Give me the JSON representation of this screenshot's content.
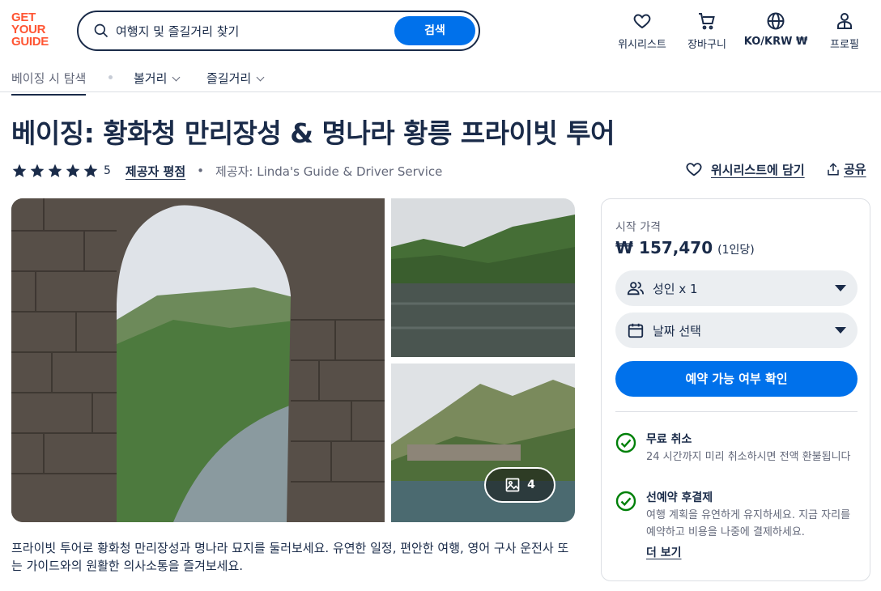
{
  "header": {
    "logo_lines": [
      "GET",
      "YOUR",
      "GUIDE"
    ],
    "search_placeholder": "여행지 및 즐길거리 찾기",
    "search_button": "검색",
    "nav": [
      {
        "label": "위시리스트",
        "icon": "heart-icon"
      },
      {
        "label": "장바구니",
        "icon": "cart-icon"
      },
      {
        "label": "KO/KRW ₩",
        "icon": "globe-icon"
      },
      {
        "label": "프로필",
        "icon": "profile-icon"
      }
    ]
  },
  "subnav": {
    "explore": "베이징 시 탐색",
    "sights": "볼거리",
    "activities": "즐길거리"
  },
  "activity": {
    "title": "베이징: 황화청 만리장성 & 명나라 황릉 프라이빗 투어",
    "rating": "5",
    "stars": 5,
    "reviews_link": "제공자 평점",
    "provider": "제공자: Linda's Guide & Driver Service",
    "wishlist": "위시리스트에 담기",
    "share": "공유",
    "gallery_count": "4",
    "description": "프라이빗 투어로 황화청 만리장성과 명나라 묘지를 둘러보세요. 유연한 일정, 편안한 여행, 영어 구사 운전사 또는 가이드와의 원활한 의사소통을 즐겨보세요."
  },
  "booking": {
    "from_label": "시작 가격",
    "price": "₩ 157,470",
    "per": "(1인당)",
    "participants": "성인 x 1",
    "date": "날짜 선택",
    "check_button": "예약 가능 여부 확인",
    "features": [
      {
        "title": "무료 취소",
        "desc": "24 시간까지 미리 취소하시면 전액 환불됩니다"
      },
      {
        "title": "선예약 후결제",
        "desc": "여행 계획을 유연하게 유지하세요. 지금 자리를 예약하고 비용을 나중에 결제하세요."
      }
    ],
    "more": "더 보기"
  },
  "colors": {
    "brand": "#ff5533",
    "primary": "#0071eb",
    "text": "#1a2b49",
    "success": "#008009"
  }
}
